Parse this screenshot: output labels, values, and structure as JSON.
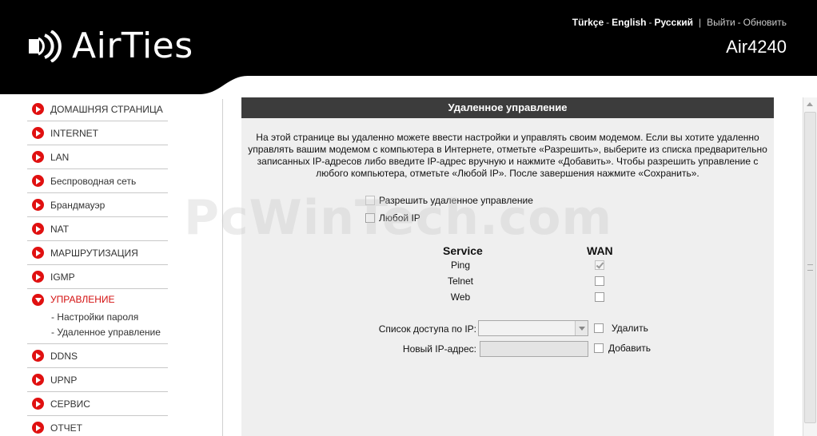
{
  "header": {
    "logo_text": "AirTies",
    "languages": [
      "Türkçe",
      "English",
      "Русский"
    ],
    "actions": [
      "Выйти",
      "Обновить"
    ],
    "model": "Air4240"
  },
  "sidebar": {
    "items": [
      {
        "label": "ДОМАШНЯЯ СТРАНИЦА"
      },
      {
        "label": "INTERNET"
      },
      {
        "label": "LAN"
      },
      {
        "label": "Беспроводная сеть"
      },
      {
        "label": "Брандмауэр"
      },
      {
        "label": "NAT"
      },
      {
        "label": "МАРШРУТИЗАЦИЯ"
      },
      {
        "label": "IGMP"
      },
      {
        "label": "УПРАВЛЕНИЕ",
        "sub": [
          "- Настройки пароля",
          "- Удаленное управление"
        ]
      },
      {
        "label": "DDNS"
      },
      {
        "label": "UPNP"
      },
      {
        "label": "СЕРВИС"
      },
      {
        "label": "ОТЧЕТ"
      }
    ]
  },
  "content": {
    "title": "Удаленное управление",
    "description": "На этой странице вы удаленно можете ввести настройки и управлять своим модемом. Если вы хотите удаленно управлять вашим модемом с компьютера в Интернете, отметьте «Разрешить», выберите из списка предварительно записанных IP-адресов либо введите IP-адрес вручную и нажмите «Добавить». Чтобы разрешить управление с любого компьютера, отметьте «Любой IP». После завершения нажмите «Сохранить».",
    "allow_label": "Разрешить удаленное управление",
    "any_ip_label": "Любой IP",
    "table": {
      "service_header": "Service",
      "wan_header": "WAN",
      "rows": [
        {
          "service": "Ping",
          "wan_checked": true
        },
        {
          "service": "Telnet",
          "wan_checked": false
        },
        {
          "service": "Web",
          "wan_checked": false
        }
      ]
    },
    "ip_list_label": "Список доступа по IP:",
    "delete_label": "Удалить",
    "new_ip_label": "Новый IP-адрес:",
    "new_ip_value": "",
    "add_label": "Добавить"
  },
  "watermark": "PcWinTech.com",
  "colors": {
    "accent": "#e01010",
    "header_bg": "#000000",
    "title_bar": "#3c3c3c",
    "content_bg": "#efefef"
  }
}
